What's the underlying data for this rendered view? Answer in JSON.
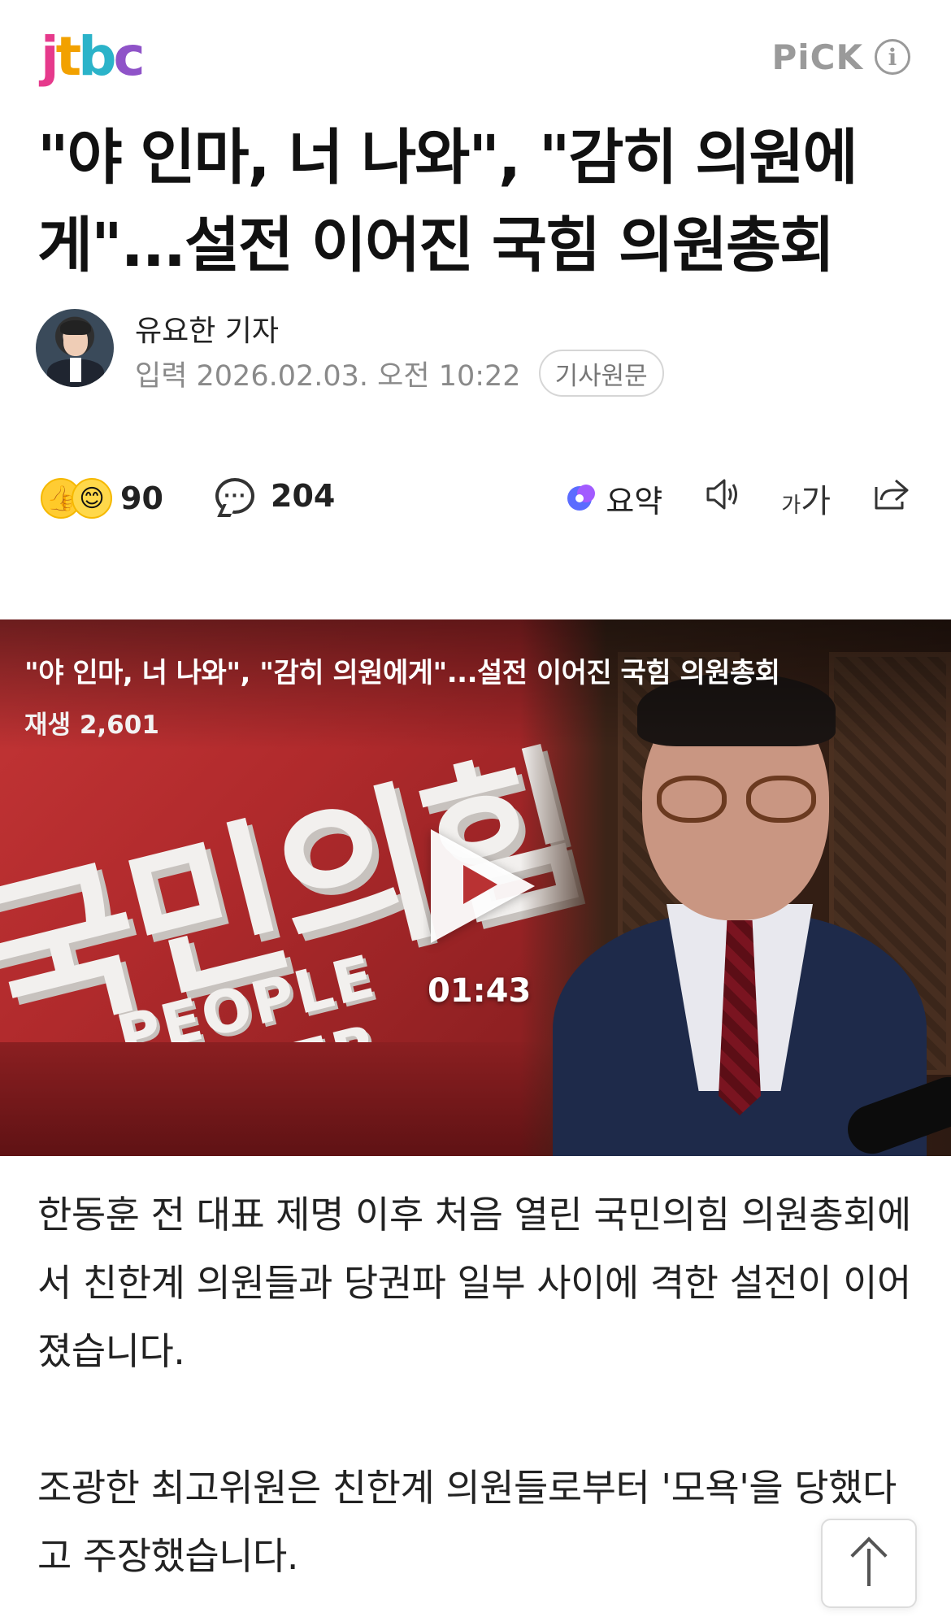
{
  "header": {
    "logo_text": "jtbc",
    "pick_label": "PiCK",
    "info_icon": "info-icon"
  },
  "article": {
    "headline": "\"야 인마, 너 나와\", \"감히 의원에게\"...설전 이어진 국힘 의원총회",
    "author": "유요한 기자",
    "date": "입력 2026.02.03. 오전 10:22",
    "original_label": "기사원문"
  },
  "actions": {
    "reaction_count": "90",
    "comment_count": "204",
    "summary_label": "요약",
    "comment_icon_glyph": "···",
    "speaker_icon": "speaker-icon",
    "fontsize_small": "가",
    "fontsize_big": "가",
    "share_icon": "share-icon"
  },
  "video": {
    "title": "\"야 인마, 너 나와\", \"감히 의원에게\"...설전 이어진 국힘 의원총회",
    "views": "재생 2,601",
    "duration": "01:43",
    "logo_big": "국민의힘",
    "logo_small": "PEOPLE POWER"
  },
  "body": {
    "paragraphs": [
      "한동훈 전 대표 제명 이후 처음 열린 국민의힘 의원총회에서 친한계 의원들과 당권파 일부 사이에 격한 설전이 이어졌습니다.",
      "조광한 최고위원은 친한계 의원들로부터 '모욕'을 당했다고 주장했습니다."
    ]
  },
  "colors": {
    "pick_gray": "#9a9a9a",
    "video_red": "#c43536",
    "text": "#222222"
  }
}
